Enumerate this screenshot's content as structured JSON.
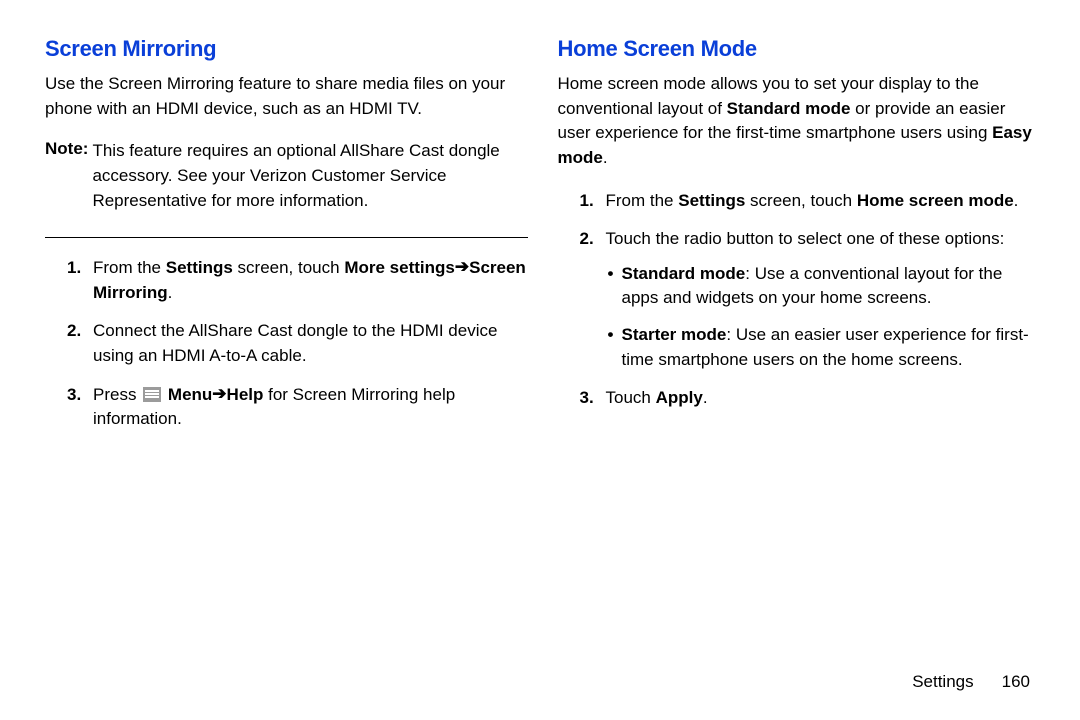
{
  "left": {
    "heading": "Screen Mirroring",
    "intro": "Use the Screen Mirroring feature to share media files on your phone with an HDMI device, such as an HDMI TV.",
    "note_label": "Note:",
    "note_body": "This feature requires an optional AllShare Cast dongle accessory. See your Verizon Customer Service Representative for more information.",
    "s1_pre": "From the ",
    "s1_b1": "Settings",
    "s1_mid": " screen, touch ",
    "s1_b2": "More settings",
    "s1_arrow": " ➔ ",
    "s1_b3": "Screen Mirroring",
    "s1_end": ".",
    "s2": "Connect the AllShare Cast dongle to the HDMI device using an HDMI A-to-A cable.",
    "s3_pre": "Press ",
    "s3_b1": " Menu",
    "s3_arrow": " ➔ ",
    "s3_b2": "Help",
    "s3_end": " for Screen Mirroring help information."
  },
  "right": {
    "heading": "Home Screen Mode",
    "intro_pre": "Home screen mode allows you to set your display to the conventional layout of ",
    "intro_b1": "Standard mode",
    "intro_mid": " or provide an easier user experience for the first-time smartphone users using ",
    "intro_b2": "Easy mode",
    "intro_end": ".",
    "s1_pre": "From the ",
    "s1_b1": "Settings",
    "s1_mid": " screen, touch ",
    "s1_b2": "Home screen mode",
    "s1_end": ".",
    "s2": "Touch the radio button to select one of these options:",
    "opt1_b": "Standard mode",
    "opt1_rest": ": Use a conventional layout for the apps and widgets on your home screens.",
    "opt2_b": "Starter mode",
    "opt2_rest": ": Use an easier user experience for first-time smartphone users on the home screens.",
    "s3_pre": "Touch ",
    "s3_b": "Apply",
    "s3_end": "."
  },
  "footer": {
    "section": "Settings",
    "page": "160"
  }
}
